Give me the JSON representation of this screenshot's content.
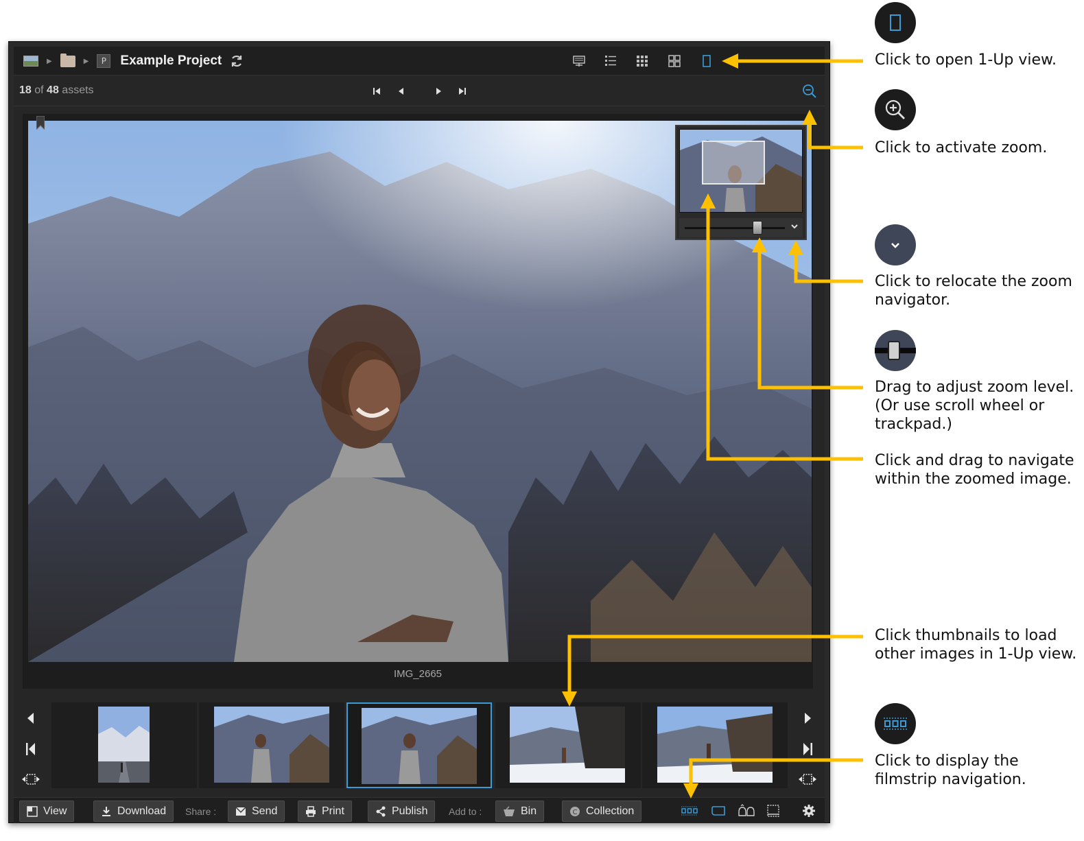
{
  "header": {
    "project_title": "Example Project",
    "breadcrumb": [
      "image-icon",
      "folder-icon",
      "project-icon"
    ],
    "project_badge": "P"
  },
  "status": {
    "current": "18",
    "of_label": "of",
    "total": "48",
    "assets_label": "assets"
  },
  "viewer": {
    "caption": "IMG_2665",
    "zoom_level_fraction": 0.75
  },
  "filmstrip": {
    "selected_index": 2,
    "thumbnail_count": 5
  },
  "toolbar": {
    "view_label": "View",
    "download_label": "Download",
    "share_label": "Share :",
    "send_label": "Send",
    "print_label": "Print",
    "publish_label": "Publish",
    "addto_label": "Add to :",
    "bin_label": "Bin",
    "collection_label": "Collection"
  },
  "annotations": {
    "open_1up": "Click to open 1-Up view.",
    "activate_zoom": "Click to activate zoom.",
    "relocate_nav": "Click to relocate the zoom navigator.",
    "adjust_zoom": "Drag to adjust zoom level. (Or use scroll wheel or trackpad.)",
    "navigate_zoom": "Click and drag to navigate within the zoomed image.",
    "thumbnails": "Click thumbnails to load other images in 1-Up view.",
    "filmstrip": "Click to display the filmstrip navigation."
  },
  "colors": {
    "accent": "#3a9bd6",
    "arrow": "#ffc000",
    "bg_dark": "#1f1f1f"
  }
}
